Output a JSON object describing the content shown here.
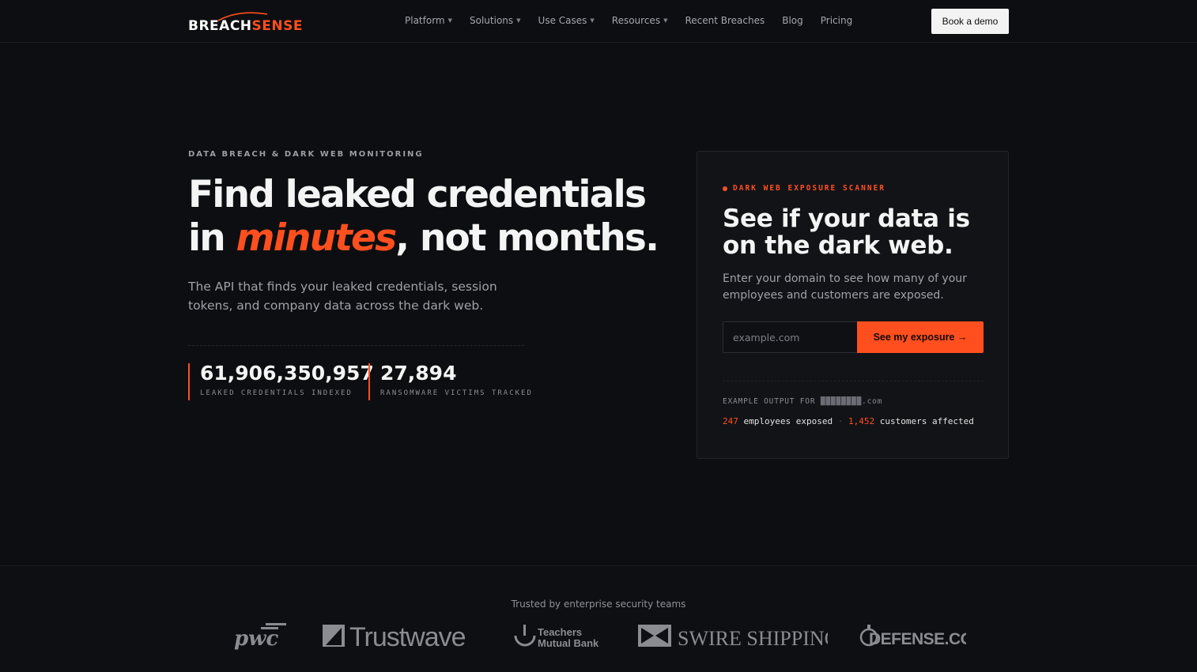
{
  "nav": {
    "logo": {
      "part1": "BREACH",
      "part2": "SENSE"
    },
    "items": [
      {
        "label": "Platform",
        "dropdown": true
      },
      {
        "label": "Solutions",
        "dropdown": true
      },
      {
        "label": "Use Cases",
        "dropdown": true
      },
      {
        "label": "Resources",
        "dropdown": true
      },
      {
        "label": "Recent Breaches",
        "dropdown": false
      },
      {
        "label": "Blog",
        "dropdown": false
      },
      {
        "label": "Pricing",
        "dropdown": false
      }
    ],
    "cta": "Book a demo"
  },
  "hero": {
    "eyebrow": "DATA BREACH & DARK WEB MONITORING",
    "headline_line1": "Find leaked credentials",
    "headline_in": "in ",
    "headline_accent": "minutes",
    "headline_end": ", not months.",
    "subhead": "The API that finds your leaked credentials, session tokens, and company data across the dark web.",
    "stats": [
      {
        "value": "61,906,350,957",
        "label": "LEAKED CREDENTIALS INDEXED"
      },
      {
        "value": "27,894",
        "label": "RANSOMWARE VICTIMS TRACKED"
      }
    ]
  },
  "scanner": {
    "tag": "DARK WEB EXPOSURE SCANNER",
    "title": "See if your data is on the dark web.",
    "subtitle": "Enter your domain to see how many of your employees and customers are exposed.",
    "input_placeholder": "example.com",
    "button": "See my exposure →",
    "example_label": "EXAMPLE OUTPUT FOR",
    "example_domain_redacted": "████████",
    "example_domain_suffix": ".com",
    "employees_count": "247",
    "employees_text": "employees exposed",
    "separator": "·",
    "customers_count": "1,452",
    "customers_text": "customers affected"
  },
  "trusted": {
    "label": "Trusted by enterprise security teams",
    "logos": [
      "pwc",
      "Trustwave",
      "Teachers Mutual Bank",
      "SWIRE SHIPPING",
      "DEFENSE.COM"
    ]
  },
  "colors": {
    "accent": "#ff4f1f",
    "background": "#0d0e11",
    "card": "#121317"
  }
}
